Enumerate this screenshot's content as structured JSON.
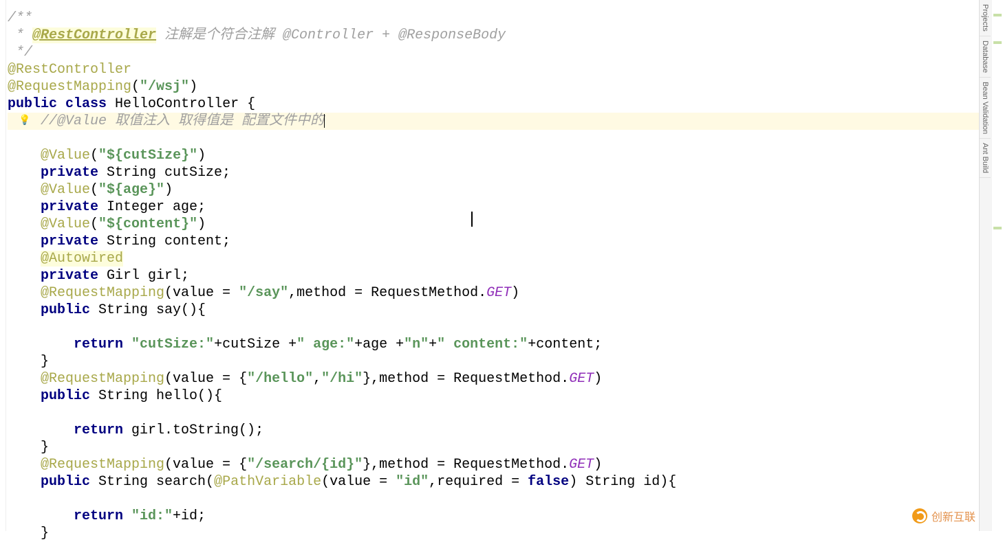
{
  "code": {
    "l01_a": "/**",
    "l02_a": " * ",
    "l02_doctag": "@RestController",
    "l02_b": " 注解是个符合注解 @Controller + @ResponseBody",
    "l03_a": " */",
    "l04_ann": "@RestController",
    "l05_ann": "@RequestMapping",
    "l05_p": "(",
    "l05_str": "\"/wsj\"",
    "l05_p2": ")",
    "l06_kw1": "public",
    "l06_kw2": "class",
    "l06_name": " HelloController {",
    "l07_cmt": "//@Value 取值注入 取得值是 配置文件中的",
    "l08_ann": "@Value",
    "l08_p": "(",
    "l08_str": "\"${cutSize}\"",
    "l08_p2": ")",
    "l09_kw": "private",
    "l09_rest": " String cutSize;",
    "l10_ann": "@Value",
    "l10_p": "(",
    "l10_str": "\"${age}\"",
    "l10_p2": ")",
    "l11_kw": "private",
    "l11_rest": " Integer age;",
    "l12_ann": "@Value",
    "l12_p": "(",
    "l12_str": "\"${content}\"",
    "l12_p2": ")",
    "l13_kw": "private",
    "l13_rest": " String content;",
    "l14_ann": "@Autowired",
    "l15_kw": "private",
    "l15_rest": " Girl girl;",
    "l16_ann": "@RequestMapping",
    "l16_a": "(value = ",
    "l16_str": "\"/say\"",
    "l16_b": ",method = RequestMethod.",
    "l16_enum": "GET",
    "l16_c": ")",
    "l17_kw": "public",
    "l17_rest": " String say(){",
    "l18_kw": "return",
    "l18_s1": " \"cutSize:\"",
    "l18_t1": "+cutSize +",
    "l18_s2": "\" age:\"",
    "l18_t2": "+age +",
    "l18_s3": "\"n\"",
    "l18_t3": "+",
    "l18_s4": "\" content:\"",
    "l18_t4": "+content;",
    "l19_b": "}",
    "l20_ann": "@RequestMapping",
    "l20_a": "(value = {",
    "l20_s1": "\"/hello\"",
    "l20_c": ",",
    "l20_s2": "\"/hi\"",
    "l20_b": "},method = RequestMethod.",
    "l20_enum": "GET",
    "l20_d": ")",
    "l21_kw": "public",
    "l21_rest": " String hello(){",
    "l22_kw": "return",
    "l22_rest": " girl.toString();",
    "l23_b": "}",
    "l24_ann": "@RequestMapping",
    "l24_a": "(value = {",
    "l24_s1": "\"/search/{id}\"",
    "l24_b": "},method = RequestMethod.",
    "l24_enum": "GET",
    "l24_c": ")",
    "l25_kw": "public",
    "l25_a": " String search(",
    "l25_ann": "@PathVariable",
    "l25_b": "(value = ",
    "l25_s": "\"id\"",
    "l25_c": ",required = ",
    "l25_kw2": "false",
    "l25_d": ") String id){",
    "l26_kw": "return",
    "l26_s": " \"id:\"",
    "l26_r": "+id;",
    "l27_b": "}"
  },
  "tabs": {
    "t1": "Projects",
    "t2": "Database",
    "t3": "Bean Validation",
    "t4": "Ant Build"
  },
  "watermark": "创新互联",
  "bulb_icon": "💡"
}
